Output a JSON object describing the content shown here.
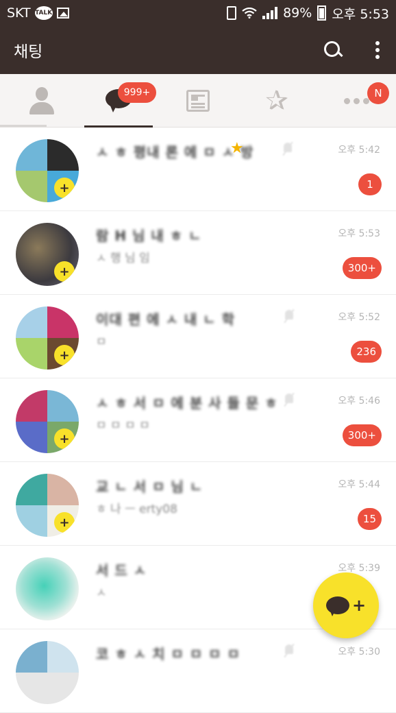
{
  "status_bar": {
    "carrier": "SKT",
    "talk_label": "TALK",
    "battery": "89%",
    "time": "오후 5:53"
  },
  "app_bar": {
    "title": "채팅",
    "search_icon": "search-icon",
    "more_icon": "more-vertical-icon"
  },
  "tabs": {
    "items": [
      {
        "name": "friends",
        "icon": "person-icon",
        "active": false
      },
      {
        "name": "chats",
        "icon": "chat-bubble-icon",
        "active": true,
        "badge": "999+"
      },
      {
        "name": "news",
        "icon": "news-icon",
        "active": false
      },
      {
        "name": "favorites",
        "icon": "star-icon",
        "active": false
      },
      {
        "name": "more",
        "icon": "more-horizontal-icon",
        "active": false,
        "badge": "N"
      }
    ]
  },
  "chats": [
    {
      "name": "ㅅ ㅎ 평내 론 에 ㅁ ㅅ 방",
      "preview": "",
      "time": "오후 5:42",
      "unread": "1",
      "starred": true,
      "muted": true
    },
    {
      "name": "람 H 님 내 ㅎ ㄴ",
      "preview": "ㅅ 행 님 임",
      "time": "오후 5:53",
      "unread": "300+",
      "starred": false,
      "muted": false
    },
    {
      "name": "이대 편 에 ㅅ 내 ㄴ 학",
      "preview": "ㅁ",
      "time": "오후 5:52",
      "unread": "236",
      "starred": false,
      "muted": true
    },
    {
      "name": "ㅅ ㅎ 서 ㅁ 에 분 사 들 문 ㅎ",
      "preview": "ㅁ ㅁ ㅁ ㅁ",
      "time": "오후 5:46",
      "unread": "300+",
      "starred": false,
      "muted": true
    },
    {
      "name": "교 ㄴ 서 ㅁ 님 ㄴ",
      "preview": "ㅎ 나 ㅡ erty08",
      "time": "오후 5:44",
      "unread": "15",
      "starred": false,
      "muted": false
    },
    {
      "name": "서 드 ㅅ",
      "preview": "ㅅ",
      "time": "오후 5:39",
      "unread": "",
      "starred": false,
      "muted": false
    },
    {
      "name": "코 ㅎ ㅅ 치 ㅁ ㅁ ㅁ ㅁ",
      "preview": "",
      "time": "오후 5:30",
      "unread": "",
      "starred": false,
      "muted": true
    }
  ],
  "fab": {
    "icon": "new-chat-icon"
  },
  "colors": {
    "header": "#3a2e2b",
    "badge": "#ec4f3e",
    "accent_yellow": "#f8e12a"
  }
}
